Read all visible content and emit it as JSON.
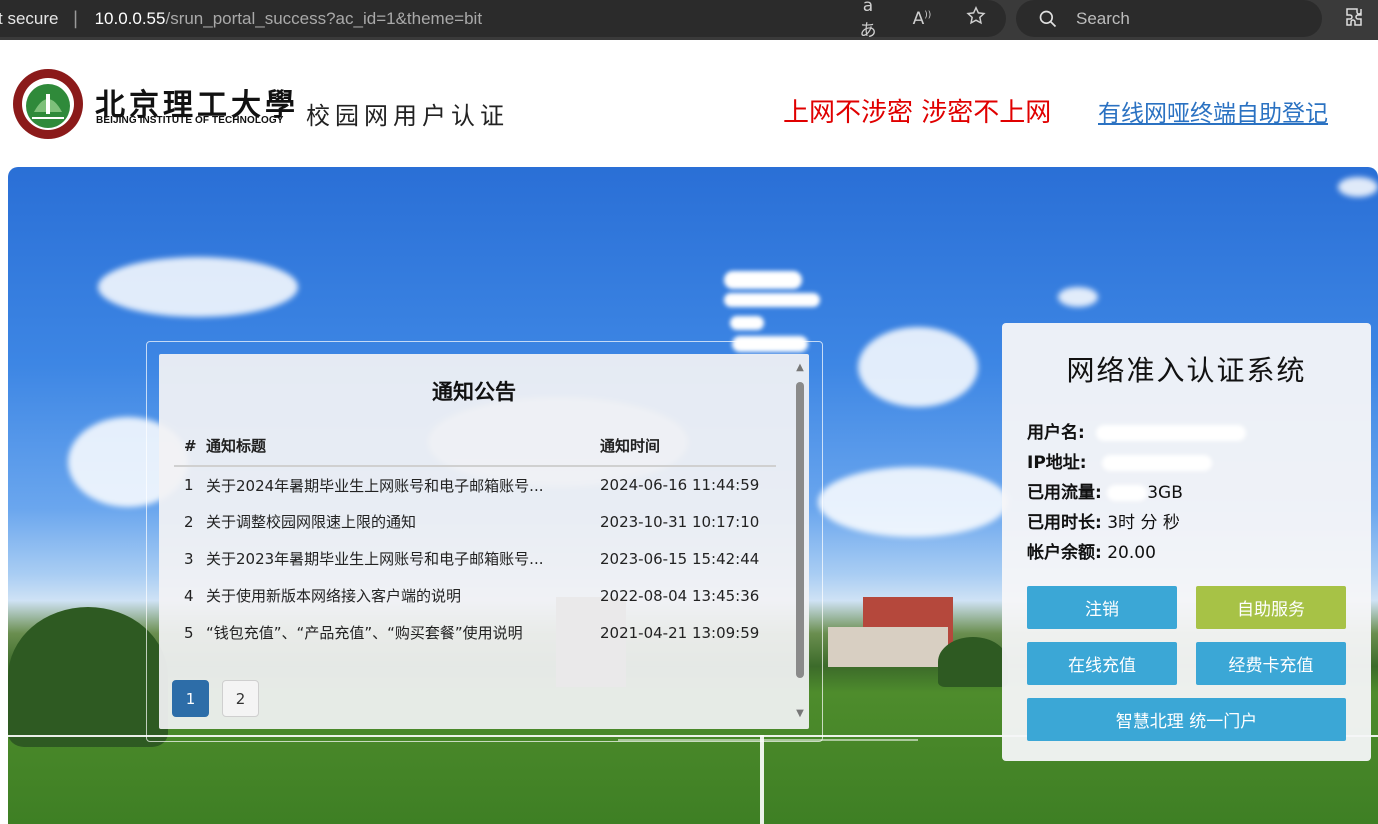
{
  "browser": {
    "security_label": "t secure",
    "url_host": "10.0.0.55",
    "url_path": "/srun_portal_success?ac_id=1&theme=bit",
    "icons": [
      "read-aloud-icon",
      "text-size-icon",
      "favorite-star-icon"
    ],
    "search_placeholder": "Search"
  },
  "header": {
    "logo_cn": "北京理工大學",
    "logo_en": "BEIJING INSTITUTE OF TECHNOLOGY",
    "logo_sub": "校园网用户认证",
    "slogan": "上网不涉密 涉密不上网",
    "register_link": "有线网哑终端自助登记"
  },
  "notice": {
    "title": "通知公告",
    "columns": [
      "#",
      "通知标题",
      "通知时间"
    ],
    "rows": [
      {
        "idx": "1",
        "title": "关于2024年暑期毕业生上网账号和电子邮箱账号...",
        "time": "2024-06-16 11:44:59"
      },
      {
        "idx": "2",
        "title": "关于调整校园网限速上限的通知",
        "time": "2023-10-31 10:17:10"
      },
      {
        "idx": "3",
        "title": "关于2023年暑期毕业生上网账号和电子邮箱账号...",
        "time": "2023-06-15 15:42:44"
      },
      {
        "idx": "4",
        "title": "关于使用新版本网络接入客户端的说明",
        "time": "2022-08-04 13:45:36"
      },
      {
        "idx": "5",
        "title": "“钱包充值”、“产品充值”、“购买套餐”使用说明",
        "time": "2021-04-21 13:09:59"
      }
    ],
    "pages": [
      "1",
      "2"
    ],
    "current_page": "1"
  },
  "account": {
    "title": "网络准入认证系统",
    "username_label": "用户名:",
    "ip_label": "IP地址:",
    "traffic_label": "已用流量:",
    "traffic_value_suffix": "3GB",
    "duration_label": "已用时长:",
    "duration_value": "3时  分  秒",
    "balance_label": "帐户余额:",
    "balance_value": "20.00",
    "buttons": {
      "logout": "注销",
      "self_service": "自助服务",
      "online_recharge": "在线充值",
      "card_recharge": "经费卡充值",
      "portal": "智慧北理 统一门户"
    },
    "colors": {
      "blue": "#3ba7d6",
      "olive": "#a7c246"
    }
  }
}
